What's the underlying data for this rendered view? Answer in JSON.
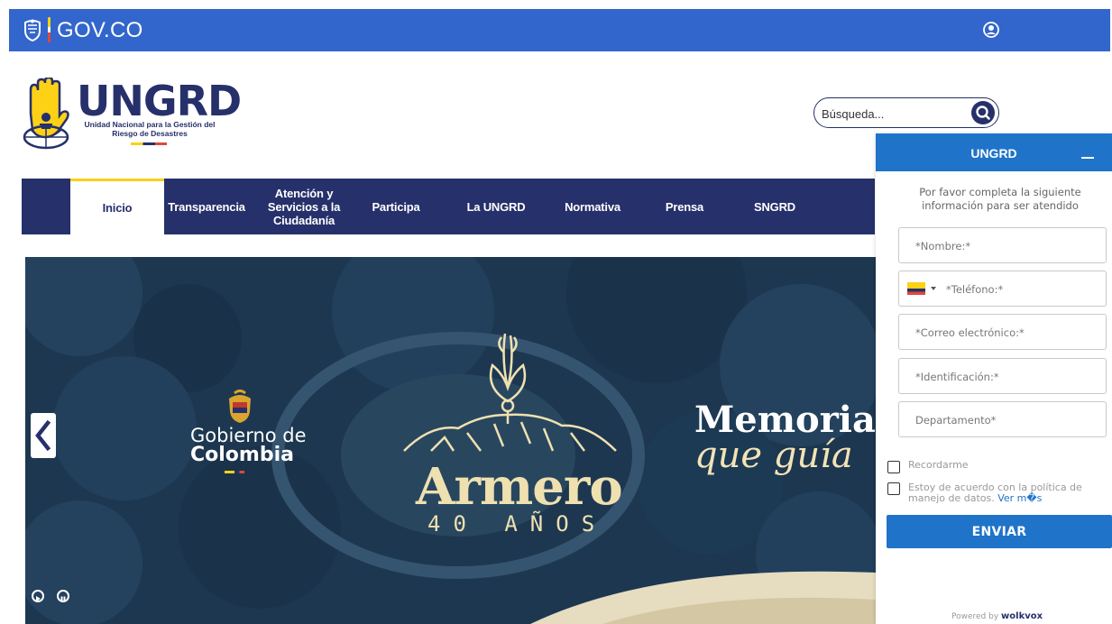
{
  "govbar": {
    "brand": "GOV.CO",
    "shield_icon": "colombia-shield-icon",
    "user_icon": "user-circle-icon",
    "color": "#3366cc"
  },
  "header": {
    "logo_title": "UNGRD",
    "logo_subtitle": "Unidad Nacional para la Gestión del Riesgo de Desastres",
    "search_placeholder": "Búsqueda...",
    "search_icon": "search-icon"
  },
  "nav": {
    "items": [
      {
        "label": "Inicio",
        "active": true
      },
      {
        "label": "Transparencia"
      },
      {
        "label": "Atención y Servicios a la Ciudadanía"
      },
      {
        "label": "Participa"
      },
      {
        "label": "La UNGRD"
      },
      {
        "label": "Normativa"
      },
      {
        "label": "Prensa"
      },
      {
        "label": "SNGRD"
      }
    ],
    "color": "#26306a"
  },
  "hero": {
    "gobierno_line1": "Gobierno de",
    "gobierno_line2": "Colombia",
    "armero": "Armero",
    "anos": "40 AÑOS",
    "memoria": "Memoria",
    "que_guia": "que guía",
    "prev_icon": "chevron-left-icon",
    "play_icon": "play-icon",
    "pause_icon": "pause-icon"
  },
  "chat": {
    "title": "UNGRD",
    "intro": "Por favor completa la siguiente información para ser atendido",
    "fields": {
      "nombre": "*Nombre:*",
      "telefono": "*Teléfono:*",
      "correo": "*Correo electrónico:*",
      "identificacion": "*Identificación:*",
      "departamento": "Departamento*"
    },
    "remember": "Recordarme",
    "policy": "Estoy de acuerdo con la política de manejo de datos.",
    "policy_link": "Ver m�s",
    "send": "ENVIAR",
    "powered_prefix": "Powered by",
    "powered_brand": "wolkvox",
    "accent": "#1f73c9"
  }
}
